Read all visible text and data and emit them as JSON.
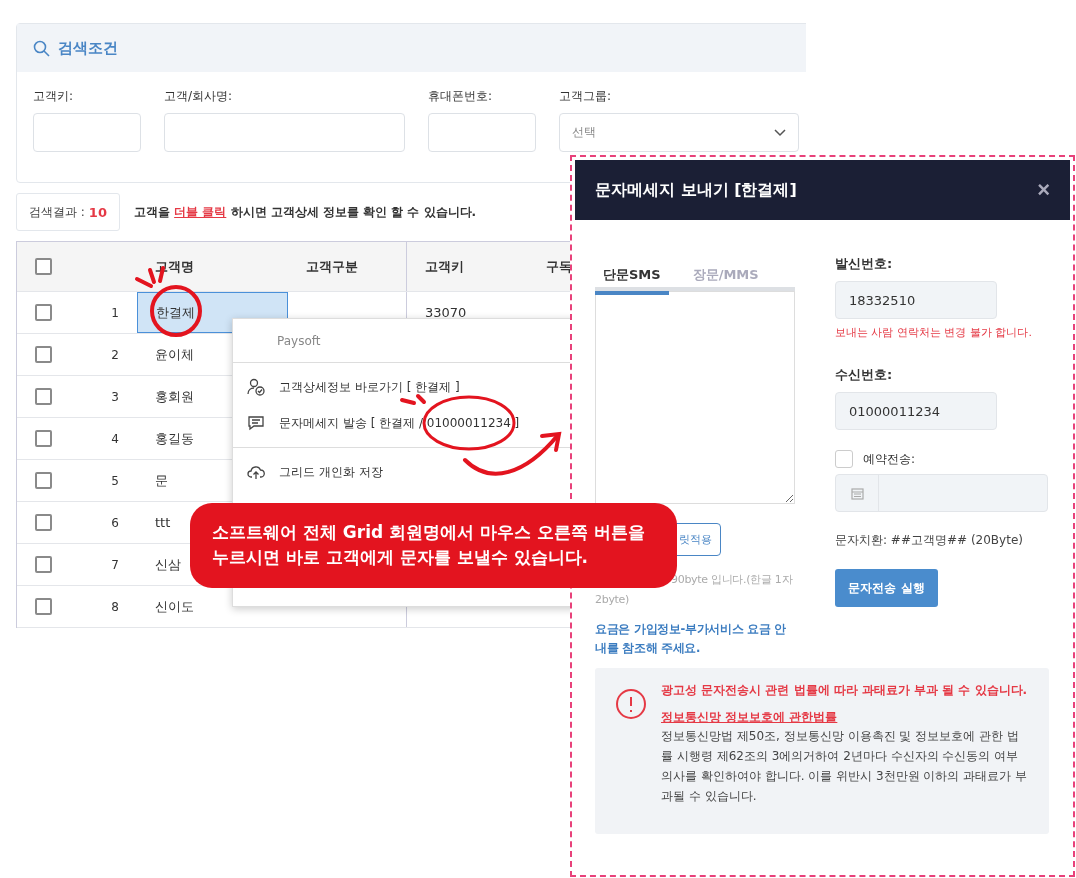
{
  "search": {
    "title": "검색조건",
    "fields": [
      {
        "label": "고객키:",
        "kind": "text"
      },
      {
        "label": "고객/회사명:",
        "kind": "text"
      },
      {
        "label": "휴대폰번호:",
        "kind": "text"
      },
      {
        "label": "고객그룹:",
        "kind": "select",
        "placeholder": "선택"
      }
    ]
  },
  "result": {
    "label": "검색결과 :",
    "count": "10",
    "hint_before": "고객을",
    "hint_link": "더블 클릭",
    "hint_after": "하시면 고객상세 정보를 확인 할 수 있습니다."
  },
  "grid": {
    "header_checked": false,
    "columns": [
      "고객명",
      "고객구분",
      "고객키",
      "구독"
    ],
    "rows": [
      {
        "no": "1",
        "name": "한결제",
        "key": "33070",
        "checked": false,
        "selected": true
      },
      {
        "no": "2",
        "name": "윤이체",
        "checked": false,
        "selected": false
      },
      {
        "no": "3",
        "name": "홍회원",
        "checked": false,
        "selected": false
      },
      {
        "no": "4",
        "name": "홍길동",
        "checked": false,
        "selected": false
      },
      {
        "no": "5",
        "name": "문",
        "checked": false,
        "selected": false
      },
      {
        "no": "6",
        "name": "ttt",
        "checked": false,
        "selected": false
      },
      {
        "no": "7",
        "name": "신삼",
        "checked": false,
        "selected": false
      },
      {
        "no": "8",
        "name": "신이도",
        "checked": false,
        "selected": false
      }
    ]
  },
  "context_menu": {
    "header": "Paysoft",
    "items": [
      {
        "label": "고객상세정보 바로가기 [ 한결제 ]",
        "kind": "user"
      },
      {
        "label": "문자메세지 발송 [ 한결제 / 01000011234 ]",
        "kind": "message"
      },
      {
        "label": "그리드 개인화 저장",
        "kind": "cloud"
      }
    ]
  },
  "modal": {
    "title": "문자메세지 보내기 [한결제]",
    "close": "×",
    "tabs": [
      {
        "label": "단문SMS",
        "selected": true
      },
      {
        "label": "장문/MMS",
        "selected": false
      }
    ],
    "template_button": "릿적용",
    "byte_note": "90byte 입니다.(한글 1자 2byte)",
    "fee_note": "요금은 가입정보-부가서비스 요금 안내를 참조해 주세요.",
    "sender": {
      "label": "발신번호:",
      "value": "18332510",
      "note": "보내는 사람 연락처는 변경 불가 합니다."
    },
    "receiver": {
      "label": "수신번호:",
      "value": "01000011234"
    },
    "reserve": {
      "label": "예약전송:",
      "checked": false
    },
    "substitution": "문자치환: ##고객명## (20Byte)",
    "send_button": "문자전송 실행",
    "warning": {
      "title": "광고성 문자전송시 관련 법률에 따라 과태료가 부과 될 수 있습니다.",
      "law_link": "정보통신망 정보보호에 관한법률",
      "body": "정보통신망법 제50조, 정보통신망 이용촉진 및 정보보호에 관한 법률 시행령 제62조의 3에의거하여 2년마다 수신자의 수신동의 여부 의사를 확인하여야 합니다. 이를 위반시 3천만원 이하의 과태료가 부과될 수 있습니다."
    }
  },
  "callout": {
    "lines": [
      "소프트웨어 전체 Grid 회원명에서 마우스 오른쪽 버튼을",
      "누르시면 바로 고객에게 문자를 보낼수 있습니다."
    ]
  }
}
